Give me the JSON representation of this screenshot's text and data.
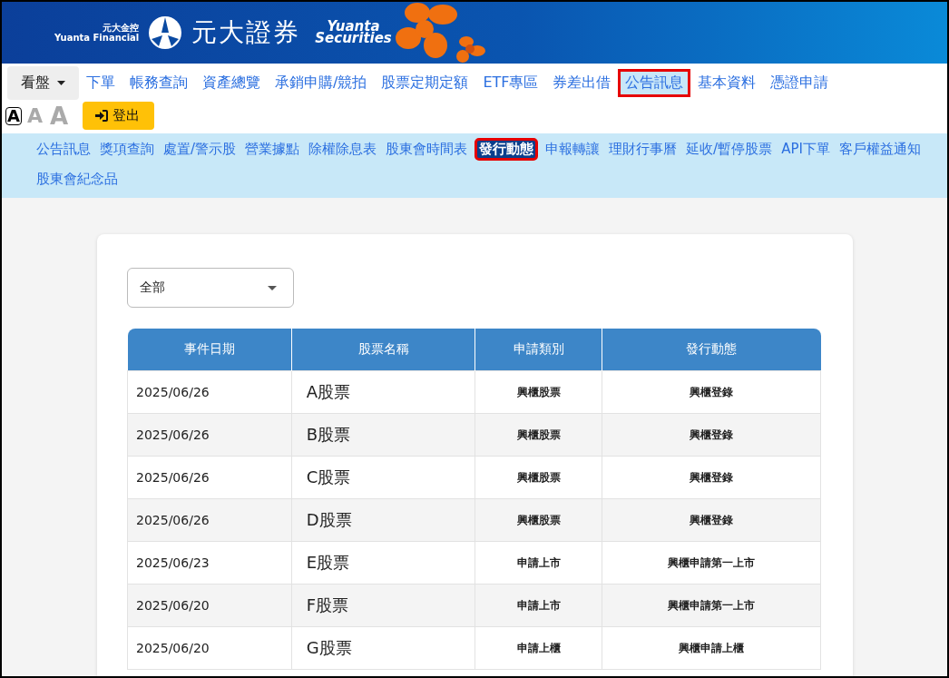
{
  "header": {
    "group_name": "元大金控",
    "group_name_en": "Yuanta Financial",
    "brand": "元大證券",
    "brand_en_1": "Yuanta",
    "brand_en_2": "Securities"
  },
  "main_nav": [
    {
      "label": "看盤",
      "kind": "dropdown",
      "selected": false,
      "annotated": false
    },
    {
      "label": "下單",
      "kind": "link",
      "selected": false,
      "annotated": false
    },
    {
      "label": "帳務查詢",
      "kind": "link",
      "selected": false,
      "annotated": false
    },
    {
      "label": "資產總覽",
      "kind": "link",
      "selected": false,
      "annotated": false
    },
    {
      "label": "承銷申購/競拍",
      "kind": "link",
      "selected": false,
      "annotated": false
    },
    {
      "label": "股票定期定額",
      "kind": "link",
      "selected": false,
      "annotated": false
    },
    {
      "label": "ETF專區",
      "kind": "link",
      "selected": false,
      "annotated": false
    },
    {
      "label": "券差出借",
      "kind": "link",
      "selected": false,
      "annotated": false
    },
    {
      "label": "公告訊息",
      "kind": "link",
      "selected": true,
      "annotated": true
    },
    {
      "label": "基本資料",
      "kind": "link",
      "selected": false,
      "annotated": false
    },
    {
      "label": "憑證申請",
      "kind": "link",
      "selected": false,
      "annotated": false
    }
  ],
  "font_sizes": [
    {
      "label": "A",
      "selected": true
    },
    {
      "label": "A",
      "selected": false
    },
    {
      "label": "A",
      "selected": false
    }
  ],
  "logout": {
    "label": "登出"
  },
  "sub_nav": [
    {
      "label": "公告訊息",
      "selected": false,
      "annotated": false
    },
    {
      "label": "獎項查詢",
      "selected": false,
      "annotated": false
    },
    {
      "label": "處置/警示股",
      "selected": false,
      "annotated": false
    },
    {
      "label": "營業據點",
      "selected": false,
      "annotated": false
    },
    {
      "label": "除權除息表",
      "selected": false,
      "annotated": false
    },
    {
      "label": "股東會時間表",
      "selected": false,
      "annotated": false
    },
    {
      "label": "發行動態",
      "selected": true,
      "annotated": true
    },
    {
      "label": "申報轉讓",
      "selected": false,
      "annotated": false
    },
    {
      "label": "理財行事曆",
      "selected": false,
      "annotated": false
    },
    {
      "label": "延收/暫停股票",
      "selected": false,
      "annotated": false
    },
    {
      "label": "API下單",
      "selected": false,
      "annotated": false
    },
    {
      "label": "客戶權益通知",
      "selected": false,
      "annotated": false
    },
    {
      "label": "股東會紀念品",
      "selected": false,
      "annotated": false
    }
  ],
  "filter": {
    "value": "全部"
  },
  "table": {
    "columns": [
      "事件日期",
      "股票名稱",
      "申請類別",
      "發行動態"
    ],
    "rows": [
      [
        "2025/06/26",
        "A股票",
        "興櫃股票",
        "興櫃登錄"
      ],
      [
        "2025/06/26",
        "B股票",
        "興櫃股票",
        "興櫃登錄"
      ],
      [
        "2025/06/26",
        "C股票",
        "興櫃股票",
        "興櫃登錄"
      ],
      [
        "2025/06/26",
        "D股票",
        "興櫃股票",
        "興櫃登錄"
      ],
      [
        "2025/06/23",
        "E股票",
        "申請上市",
        "興櫃申請第一上市"
      ],
      [
        "2025/06/20",
        "F股票",
        "申請上市",
        "興櫃申請第一上市"
      ],
      [
        "2025/06/20",
        "G股票",
        "申請上櫃",
        "興櫃申請上櫃"
      ]
    ]
  }
}
